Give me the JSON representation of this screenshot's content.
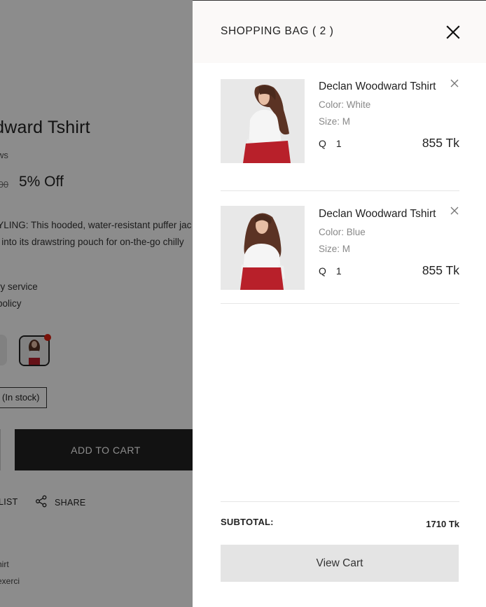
{
  "background_page": {
    "title": "odward Tshirt",
    "reviews": "ws",
    "old_price": ".00",
    "discount": "5% Off",
    "description_line1": "TYLING: This hooded, water-resistant puffer jac",
    "description_line2": "le into its drawstring pouch for on-the-go chilly",
    "service_line1": "ry service",
    "service_line2": "policy",
    "stock": "(In stock)",
    "add_to_cart": "ADD TO CART",
    "wishlist": "LIST",
    "share": "SHARE",
    "extra_line1": "hirt",
    "extra_line2": "exerci"
  },
  "drawer": {
    "title": "SHOPPING BAG ( 2 )",
    "items": [
      {
        "name": "Declan Woodward Tshirt",
        "color": "Color: White",
        "size": "Size: M",
        "qty_label": "Q",
        "qty": "1",
        "price": "855 Tk"
      },
      {
        "name": "Declan Woodward Tshirt",
        "color": "Color: Blue",
        "size": "Size: M",
        "qty_label": "Q",
        "qty": "1",
        "price": "855 Tk"
      }
    ],
    "subtotal_label": "SUBTOTAL:",
    "subtotal_value": "1710 Tk",
    "view_cart": "View Cart"
  },
  "colors": {
    "overlay": "#000000",
    "header_bg": "#fbf9f8",
    "button_bg": "#e4e4e4",
    "skirt_red": "#b8202a"
  }
}
